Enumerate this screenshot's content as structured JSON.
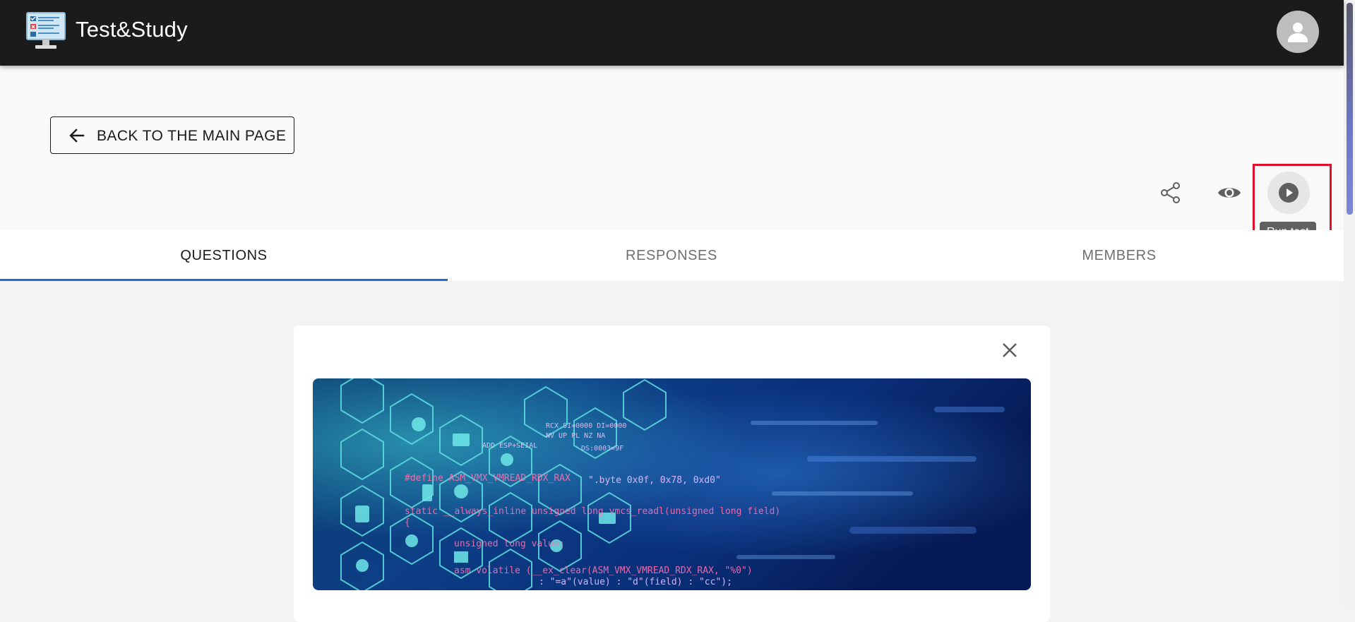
{
  "app": {
    "title": "Test&Study"
  },
  "header": {
    "back_label": "BACK TO THE MAIN PAGE",
    "actions": {
      "share_icon": "share-icon",
      "preview_icon": "eye-icon",
      "run_icon": "play-circle-icon",
      "run_tooltip": "Run test"
    }
  },
  "tabs": [
    {
      "label": "QUESTIONS",
      "active": true
    },
    {
      "label": "RESPONSES",
      "active": false
    },
    {
      "label": "MEMBERS",
      "active": false
    }
  ],
  "card": {
    "close_icon": "close-icon",
    "banner_code_lines": [
      "#define ASM_VMX_VMREAD_RDX_RAX",
      "\".byte 0x0f, 0x78, 0xd0\"",
      "static __always_inline unsigned long vmcs_readl(unsigned long field)",
      "unsigned long value;",
      "asm volatile (__ex_clear(ASM_VMX_VMREAD_RDX_RAX, \"%0\")",
      ": \"=a\"(value) : \"d\"(field) : \"cc\");",
      "RCX SI=0000 DI=0000",
      "NV UP PL NZ NA",
      "ADD  ESP+SEIAL",
      "DS:0003=9F"
    ]
  },
  "colors": {
    "appbar": "#1b1b1b",
    "tab_indicator": "#1e6fd0",
    "highlight": "#e0102b",
    "tooltip": "#616161"
  }
}
